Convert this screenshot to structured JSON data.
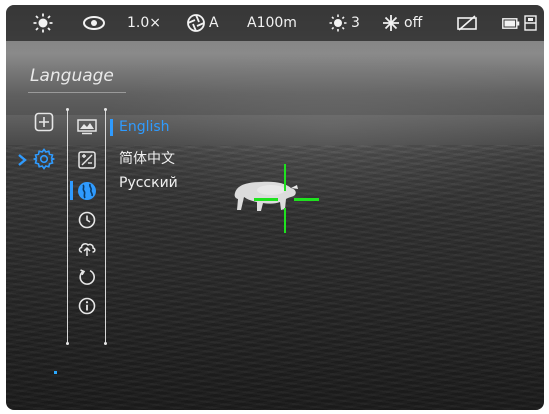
{
  "status_bar": {
    "brightness_icon": "sun-icon",
    "view_icon": "eye-icon",
    "zoom": "1.0×",
    "calibration_mode": "A",
    "rangefinder": "A100m",
    "display_brightness": "3",
    "ir_mode": "off",
    "battery_icon": "battery-icon",
    "storage_icon": "storage-icon"
  },
  "menu": {
    "title": "Language",
    "categories": [
      {
        "name": "add",
        "icon": "plus-square-icon"
      },
      {
        "name": "settings",
        "icon": "gear-icon",
        "active": true
      }
    ],
    "submenu_icons": [
      "display-icon",
      "calibration-icon",
      "globe-icon",
      "clock-icon",
      "cloud-upload-icon",
      "reset-icon",
      "info-icon"
    ],
    "languages": [
      "English",
      "简体中文",
      "Русский"
    ],
    "selected_language": "English"
  },
  "colors": {
    "accent": "#2f9bff",
    "reticle": "#1fe21f"
  }
}
